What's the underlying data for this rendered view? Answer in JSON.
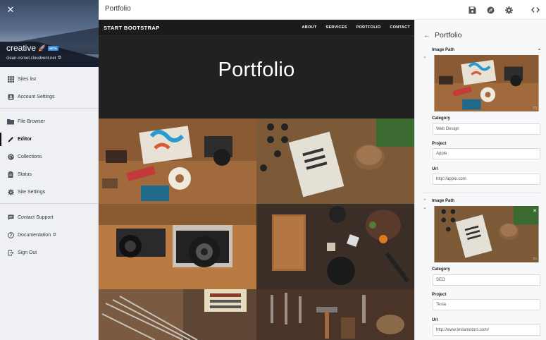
{
  "sidebar": {
    "site_name": "creative",
    "site_badge": "BETA",
    "site_url": "clean-cornet.cloudvent.net",
    "nav": [
      {
        "label": "Sites list",
        "icon": "grid-icon"
      },
      {
        "label": "Account Settings",
        "icon": "id-card-icon"
      },
      {
        "label": "File Browser",
        "icon": "folder-icon"
      },
      {
        "label": "Editor",
        "icon": "pencil-icon",
        "active": true
      },
      {
        "label": "Collections",
        "icon": "palette-icon"
      },
      {
        "label": "Status",
        "icon": "clipboard-icon"
      },
      {
        "label": "Site Settings",
        "icon": "gear-icon"
      },
      {
        "label": "Contact Support",
        "icon": "chat-icon"
      },
      {
        "label": "Documentation",
        "icon": "help-icon"
      },
      {
        "label": "Sign Out",
        "icon": "sign-out-icon"
      }
    ]
  },
  "topbar": {
    "title": "Portfolio",
    "icons": [
      "save-icon",
      "compass-icon",
      "gear-icon",
      "code-icon"
    ]
  },
  "preview": {
    "brand": "START BOOTSTRAP",
    "links": [
      "ABOUT",
      "SERVICES",
      "PORTFOLIO",
      "CONTACT"
    ],
    "heading": "Portfolio"
  },
  "panel": {
    "title": "Portfolio",
    "items": [
      {
        "image_label": "Image Path",
        "category_label": "Category",
        "category": "Web Design",
        "project_label": "Project",
        "project": "Apple",
        "url_label": "Url",
        "url": "http://apple.com"
      },
      {
        "image_label": "Image Path",
        "category_label": "Category",
        "category": "SEO",
        "project_label": "Project",
        "project": "Tesla",
        "url_label": "Url",
        "url": "http://www.teslamotors.com/"
      }
    ]
  },
  "colors": {
    "sidebar_bg": "#eef0f3",
    "preview_bg": "#212121",
    "panel_bg": "#f7f8fa",
    "accent": "#3c8fd6"
  }
}
